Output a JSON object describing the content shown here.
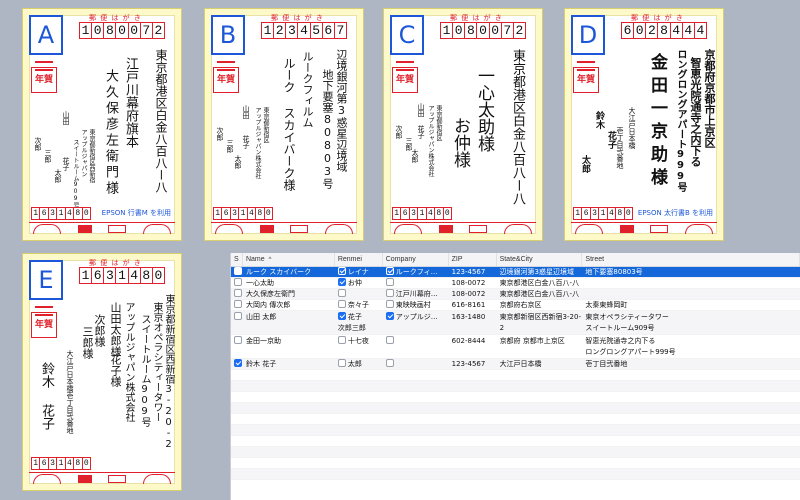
{
  "cards": {
    "a": {
      "letter": "A",
      "header": "郵 便 は が き",
      "zip": [
        "1",
        "0",
        "8",
        "0",
        "0",
        "7",
        "2"
      ],
      "address": "東京都港区白金八百八ー八",
      "name": [
        "江戸川幕府旗本",
        "大久保彦左衛門様"
      ],
      "sender_addr": [
        "東京都新宿区西新宿",
        "アップルジャパン",
        "スイートルーム909号"
      ],
      "sender_names": [
        "山田",
        "次郎",
        "三郎",
        "花子",
        "太郎"
      ],
      "sender_zip": [
        "1",
        "6",
        "3",
        "1",
        "4",
        "8",
        "0"
      ],
      "nenga": "年賀",
      "epson": "EPSON 行書M を利用"
    },
    "b": {
      "letter": "B",
      "header": "郵 便 は が き",
      "zip": [
        "1",
        "2",
        "3",
        "4",
        "5",
        "6",
        "7"
      ],
      "address": "辺境銀河第3惑星辺境域",
      "address2": "地下要塞80803号",
      "name": [
        "ルークフィルム",
        "ルーク スカイバーク様"
      ],
      "sender_addr": [
        "東京都新宿区",
        "アップルジャパン株式会社"
      ],
      "sender_names": [
        "山田",
        "次郎",
        "三郎",
        "花子",
        "太郎"
      ],
      "sender_zip": [
        "1",
        "6",
        "3",
        "1",
        "4",
        "8",
        "0"
      ],
      "nenga": "年賀"
    },
    "c": {
      "letter": "C",
      "header": "郵 便 は が き",
      "zip": [
        "1",
        "0",
        "8",
        "0",
        "0",
        "7",
        "2"
      ],
      "address": "東京都港区白金八百八ー八",
      "name": [
        "一心太助様",
        "お仲様"
      ],
      "sender_addr": [
        "東京都新宿区",
        "アップルジャパン株式会社"
      ],
      "sender_names": [
        "山田",
        "次郎",
        "三郎",
        "花子",
        "太郎"
      ],
      "sender_zip": [
        "1",
        "6",
        "3",
        "1",
        "4",
        "8",
        "0"
      ],
      "nenga": "年賀"
    },
    "d": {
      "letter": "D",
      "header": "郵 便 は が き",
      "zip": [
        "6",
        "0",
        "2",
        "8",
        "4",
        "4",
        "4"
      ],
      "address": "京都府京都市上京区",
      "address2": "智恵光院通寺之内下る",
      "address3": "ロングロングアパート999号",
      "name": [
        "金田一京助様"
      ],
      "sender_addr": [
        "大江戸日本橋",
        "壱丁目弐番地"
      ],
      "sender_names": [
        "鈴木",
        "花子",
        "太郎"
      ],
      "sender_zip": [
        "1",
        "6",
        "3",
        "1",
        "4",
        "8",
        "0"
      ],
      "nenga": "年賀",
      "epson": "EPSON 太行書B を利用"
    },
    "e": {
      "letter": "E",
      "header": "郵 便 は が き",
      "zip": [
        "1",
        "6",
        "3",
        "1",
        "4",
        "8",
        "0"
      ],
      "address": "東京都新宿区西新宿3-20-2",
      "address2": "東京オペラシティータワー",
      "address3": "スイートルーム909号",
      "name": [
        "アップルジャパン株式会社",
        "山田太郎様",
        "花子様"
      ],
      "sender_addr": [
        "大江戸日本橋壱丁目弐番地"
      ],
      "sender_names": [
        "鈴木",
        "花子"
      ],
      "sender_extra": [
        "次郎様",
        "三郎様"
      ],
      "sender_zip": [
        "1",
        "6",
        "3",
        "1",
        "4",
        "8",
        "0"
      ],
      "nenga": "年賀"
    }
  },
  "table": {
    "columns": [
      "S",
      "Name",
      "Renmei",
      "Company",
      "ZIP",
      "State&City",
      "Street"
    ],
    "rows": [
      {
        "checked": false,
        "name": "ルーク スカイバーク",
        "renmei_checked": true,
        "renmei": "レイナ",
        "company_checked": true,
        "company": "ルークフィ…",
        "zip": "123-4567",
        "state": "辺境銀河第3惑星辺境域",
        "street": "地下要塞80803号",
        "selected": true
      },
      {
        "checked": false,
        "name": "一心太助",
        "renmei_checked": true,
        "renmei": "お仲",
        "company_checked": false,
        "company": "",
        "zip": "108-0072",
        "state": "東京都港区白金八百八-八",
        "street": ""
      },
      {
        "checked": false,
        "name": "大久保彦左衛門",
        "renmei_checked": false,
        "renmei": "",
        "company_checked": false,
        "company": "江戸川幕府…",
        "zip": "108-0072",
        "state": "東京都港区白金八百八-八",
        "street": ""
      },
      {
        "checked": false,
        "name": "大岡内 傳次郎",
        "renmei_checked": false,
        "renmei": "奈々子",
        "company_checked": false,
        "company": "東映映画村",
        "zip": "616-8161",
        "state": "京都府右京区",
        "street": "太秦東蜂岡町"
      },
      {
        "checked": false,
        "name": "山田 太郎",
        "renmei_checked": true,
        "renmei": "花子",
        "renmei2": "次郎三郎",
        "company_checked": true,
        "company": "アップルジ…",
        "zip": "163-1480",
        "state": "東京都新宿区西新宿3-20-2",
        "street": "東京オペラシティータワー",
        "street2": "スイートルーム909号"
      },
      {
        "checked": false,
        "name": "金田一京助",
        "renmei_checked": false,
        "renmei": "十七夜",
        "company_checked": false,
        "company": "",
        "zip": "602-8444",
        "state": "京都府 京都市上京区",
        "street": "智恵光院通寺之内下る",
        "street2": "ロングロングアパート999号"
      },
      {
        "checked": true,
        "name": "鈴木 花子",
        "renmei_checked": false,
        "renmei": "太郎",
        "company_checked": false,
        "company": "",
        "zip": "123-4567",
        "state": "大江戸日本橋",
        "street": "壱丁目弐番地"
      }
    ]
  }
}
